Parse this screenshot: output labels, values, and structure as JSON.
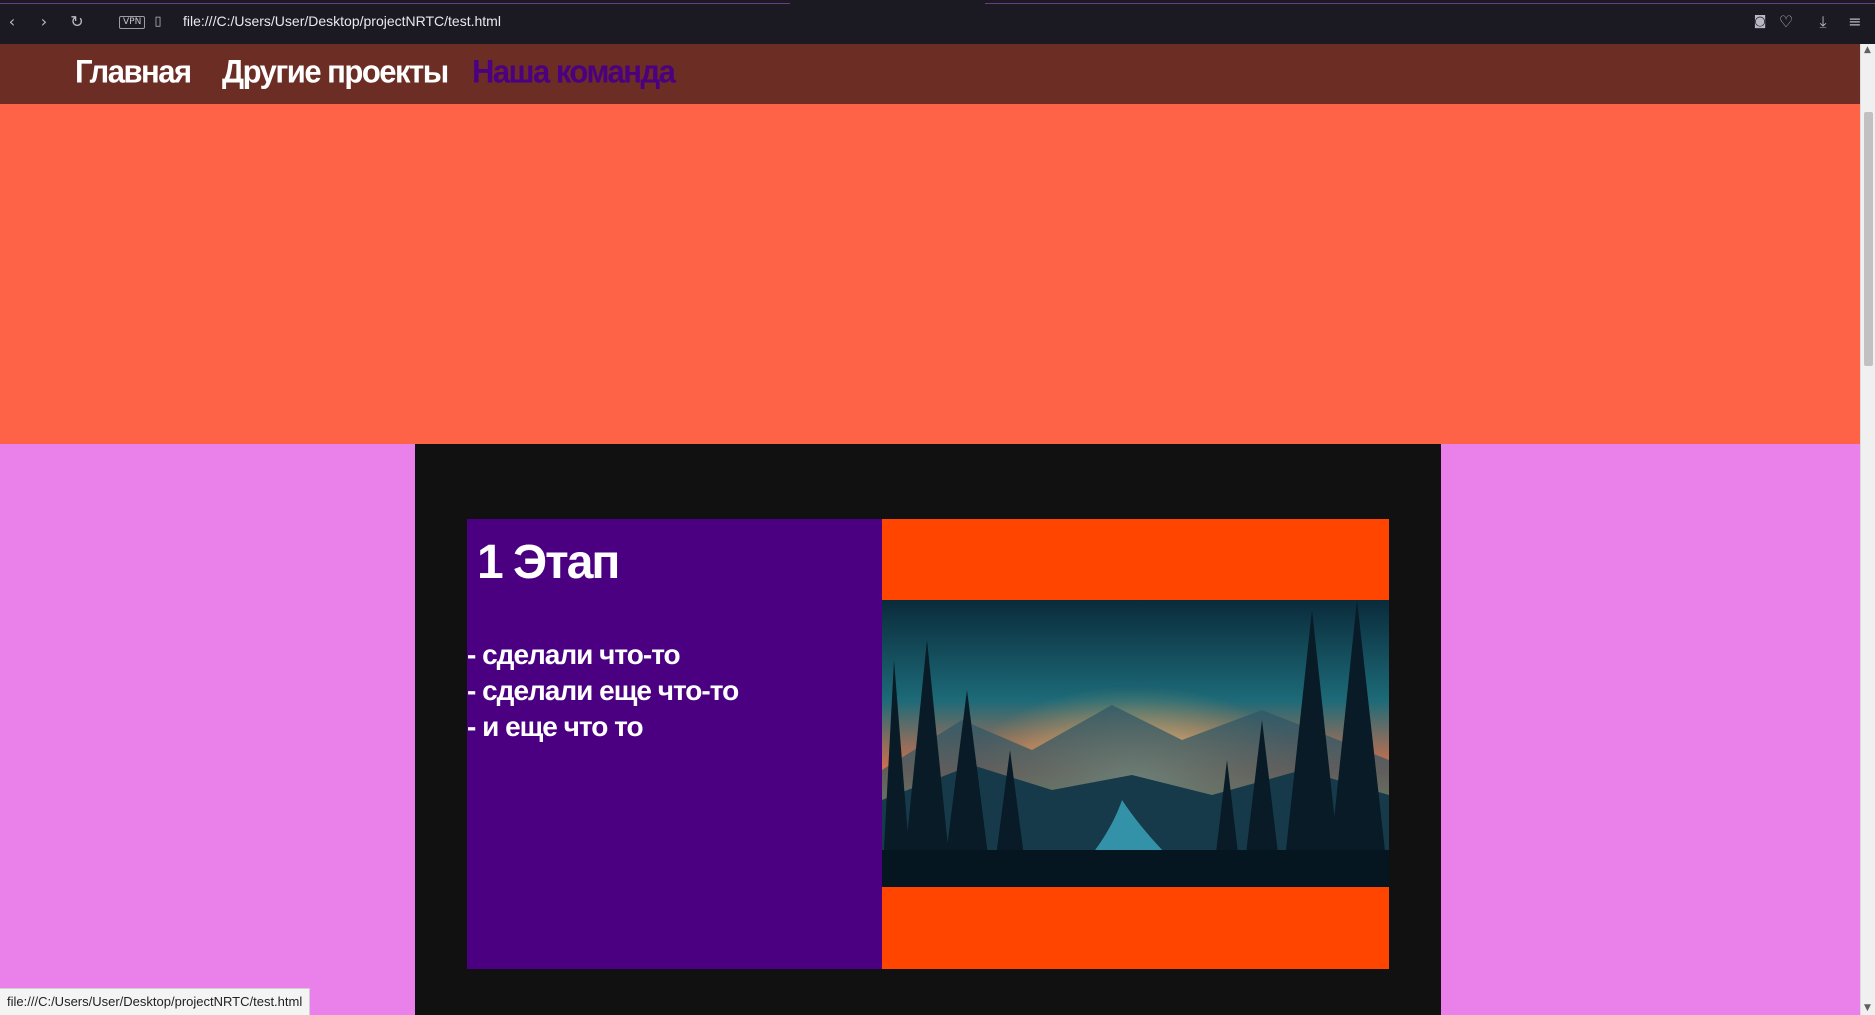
{
  "browser": {
    "url": "file:///C:/Users/User/Desktop/projectNRTC/test.html",
    "vpn_label": "VPN",
    "status_url": "file:///C:/Users/User/Desktop/projectNRTC/test.html",
    "icons": [
      "back-icon",
      "forward-icon",
      "reload-icon",
      "vpn-badge",
      "page-icon",
      "camera-icon",
      "heart-icon",
      "download-icon",
      "menu-icon"
    ]
  },
  "nav": {
    "items": [
      {
        "label": "Главная",
        "active": false
      },
      {
        "label": "Другие проекты",
        "active": false
      },
      {
        "label": "Наша команда",
        "active": true
      }
    ]
  },
  "stage": {
    "title": "1 Этап",
    "items": [
      "- сделали что-то",
      "- сделали еще что-то",
      "- и еще что то"
    ]
  },
  "colors": {
    "nav_bg": "#6b2d24",
    "hero_bg": "#ff6347",
    "section_bg": "#ea80ea",
    "panel_bg": "#111111",
    "card_left_bg": "#4b0082",
    "card_right_bg": "#ff4500",
    "nav_active": "#4b0082"
  }
}
